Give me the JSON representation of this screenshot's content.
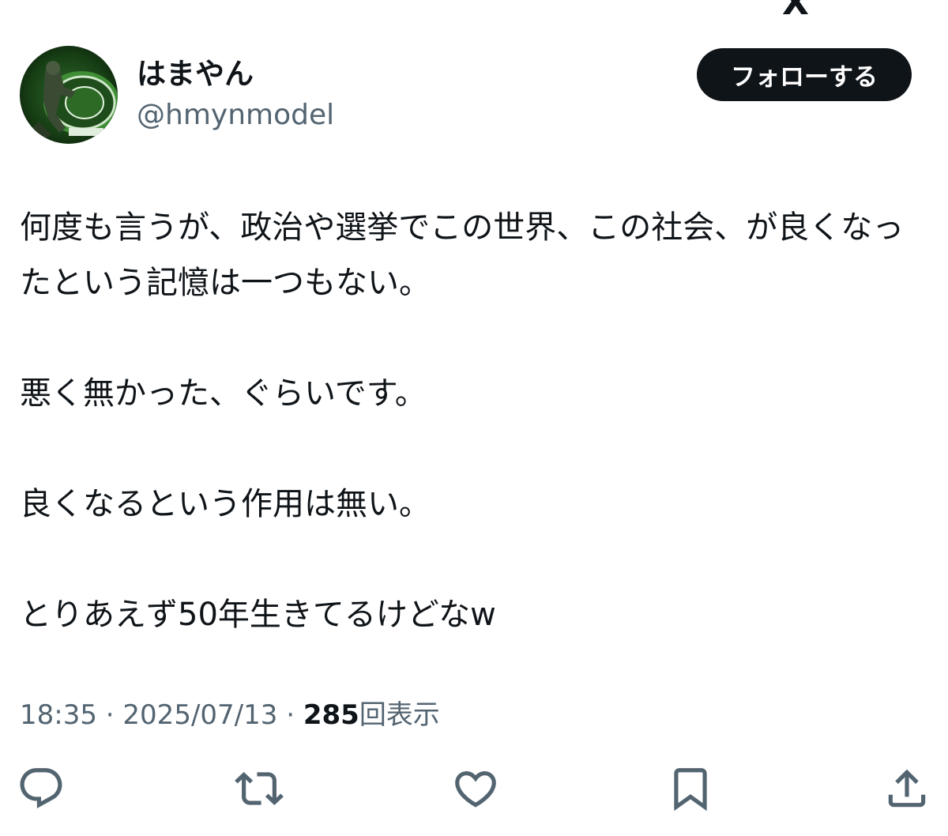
{
  "header": {
    "top_cut_glyph": "X"
  },
  "user": {
    "display_name": "はまやん",
    "handle": "@hmynmodel",
    "avatar_icon": "profile-avatar-green-figure"
  },
  "follow_button": {
    "label": "フォローする"
  },
  "tweet": {
    "paragraphs": [
      "何度も言うが、政治や選挙でこの世界、この社会、が良くなったという記憶は一つもない。",
      "悪く無かった、ぐらいです。",
      "良くなるという作用は無い。",
      "とりあえず50年生きてるけどなw"
    ]
  },
  "meta": {
    "time": "18:35",
    "separator": "·",
    "date": "2025/07/13",
    "views_count": "285",
    "views_label": "回表示"
  },
  "actions": {
    "icons": [
      "reply-icon",
      "retweet-icon",
      "like-icon",
      "bookmark-icon",
      "share-icon"
    ]
  },
  "colors": {
    "text_primary": "#0f1419",
    "text_secondary": "#536471",
    "follow_bg": "#0f1419",
    "follow_text": "#ffffff",
    "icon_color": "#536471"
  }
}
